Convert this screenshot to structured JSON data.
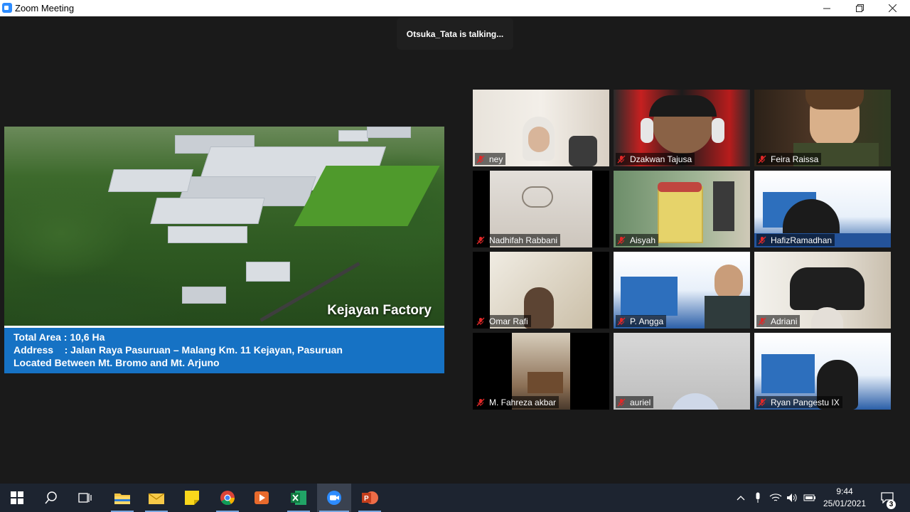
{
  "window": {
    "title": "Zoom Meeting"
  },
  "banner": {
    "talking": "Otsuka_Tata is talking..."
  },
  "share": {
    "factory_name": "Kejayan Factory",
    "info_line1": "Total Area : 10,6 Ha",
    "info_line2": "Address    : Jalan Raya Pasuruan – Malang Km. 11 Kejayan, Pasuruan",
    "info_line3": "Located Between Mt. Bromo and Mt. Arjuno"
  },
  "participants": [
    {
      "name": "ney"
    },
    {
      "name": "Dzakwan Tajusa"
    },
    {
      "name": "Feira Raissa"
    },
    {
      "name": "Nadhifah Rabbani"
    },
    {
      "name": "Aisyah"
    },
    {
      "name": "HafizRamadhan"
    },
    {
      "name": "Omar Rafi"
    },
    {
      "name": "P. Angga"
    },
    {
      "name": "Adriani"
    },
    {
      "name": "M. Fahreza akbar"
    },
    {
      "name": "auriel"
    },
    {
      "name": "Ryan Pangestu IX"
    }
  ],
  "taskbar": {
    "clock_time": "9:44",
    "clock_date": "25/01/2021",
    "notification_count": "3"
  },
  "colors": {
    "zoom_blue": "#2d8cff",
    "info_blue": "#1672c4",
    "muted_red": "#e02828"
  }
}
